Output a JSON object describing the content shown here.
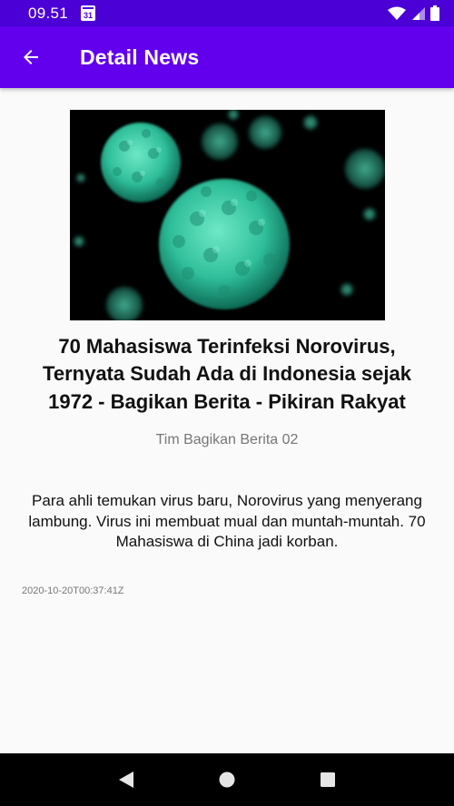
{
  "status": {
    "time": "09.51",
    "calendar_day": "31"
  },
  "app_bar": {
    "title": "Detail News"
  },
  "article": {
    "title": "70 Mahasiswa Terinfeksi Norovirus, Ternyata Sudah Ada di Indonesia sejak 1972 - Bagikan Berita - Pikiran Rakyat",
    "author": "Tim Bagikan Berita 02",
    "description": "Para ahli temukan virus baru, Norovirus yang menyerang lambung. Virus ini membuat mual dan muntah-muntah. 70 Mahasiswa di China jadi korban.",
    "published_at": "2020-10-20T00:37:41Z"
  },
  "colors": {
    "status_bar": "#4b00d6",
    "app_bar": "#6200ee",
    "virus": "#2fbf9a"
  },
  "icons": {
    "back": "arrow-left-icon",
    "nav_back": "triangle-back-icon",
    "nav_home": "circle-home-icon",
    "nav_recents": "square-recents-icon"
  }
}
